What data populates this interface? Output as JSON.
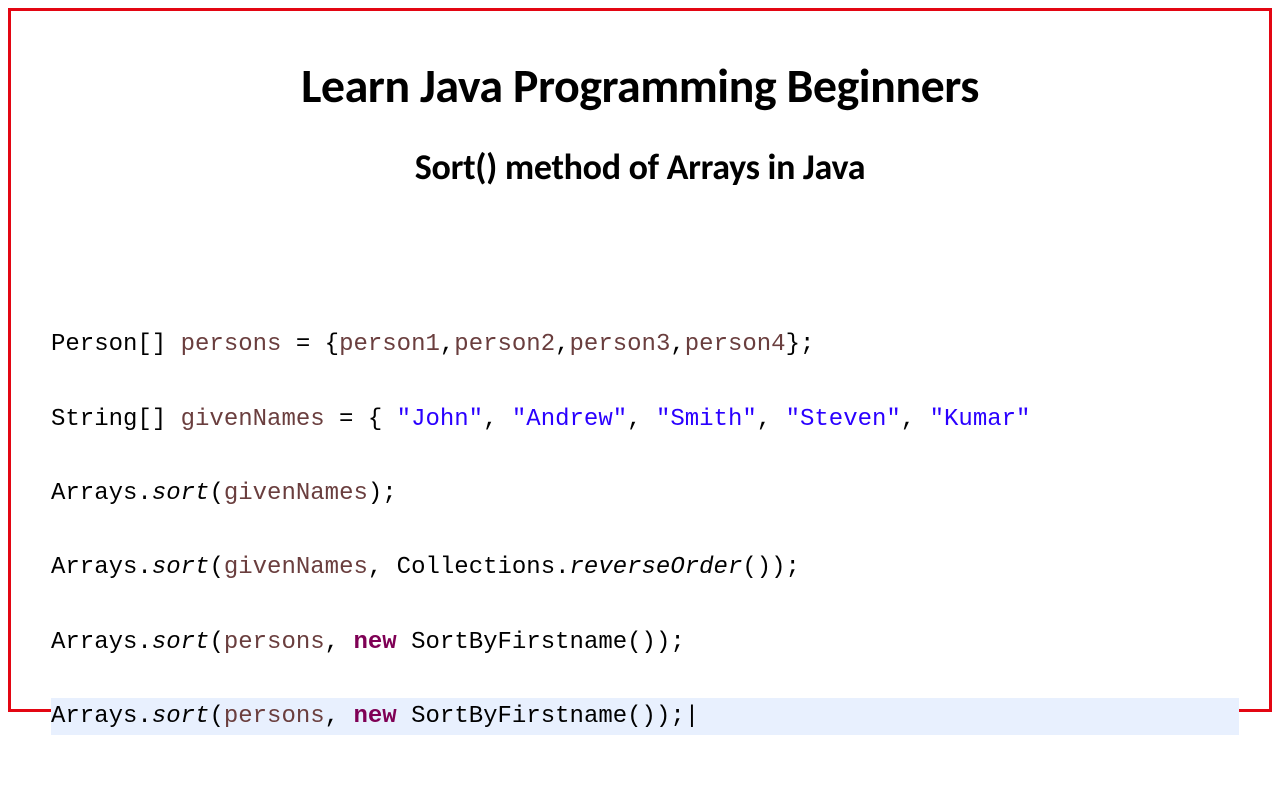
{
  "title": "Learn Java Programming Beginners",
  "subtitle": "Sort() method of Arrays in Java",
  "code": {
    "line1": {
      "prefix": "Person[] ",
      "var": "persons",
      "mid": " = {",
      "v1": "person1",
      "c1": ",",
      "v2": "person2",
      "c2": ",",
      "v3": "person3",
      "c3": ",",
      "v4": "person4",
      "suffix": "};"
    },
    "line2": {
      "prefix": "String[] ",
      "var": "givenNames",
      "mid": " = { ",
      "s1": "\"John\"",
      "c1": ", ",
      "s2": "\"Andrew\"",
      "c2": ", ",
      "s3": "\"Smith\"",
      "c3": ", ",
      "s4": "\"Steven\"",
      "c4": ", ",
      "s5": "\"Kumar\""
    },
    "line3": {
      "prefix": "Arrays.",
      "method": "sort",
      "open": "(",
      "arg": "givenNames",
      "close": ");"
    },
    "line4": {
      "prefix": "Arrays.",
      "method": "sort",
      "open": "(",
      "arg1": "givenNames",
      "c1": ", Collections.",
      "method2": "reverseOrder",
      "close": "());"
    },
    "line5": {
      "prefix": "Arrays.",
      "method": "sort",
      "open": "(",
      "arg1": "persons",
      "c1": ", ",
      "kw": "new",
      "sp": " ",
      "cls": "SortByFirstname());"
    },
    "line6": {
      "prefix": "Arrays.",
      "method": "sort",
      "open": "(",
      "arg1": "persons",
      "c1": ", ",
      "kw": "new",
      "sp": " ",
      "cls": "SortByFirstname());"
    }
  }
}
